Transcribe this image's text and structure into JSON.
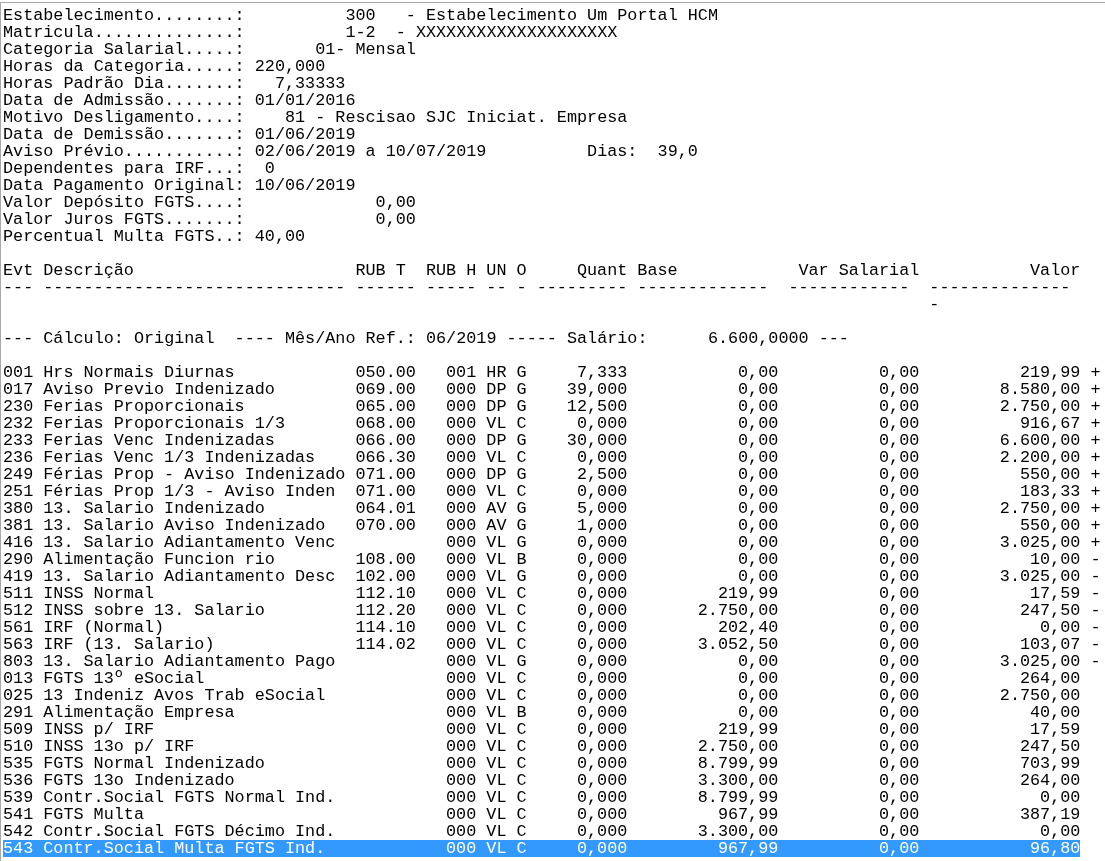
{
  "header_fields": [
    {
      "label": "Estabelecimento........:",
      "value": "300   - Estabelecimento Um Portal HCM"
    },
    {
      "label": "Matricula..............:",
      "value": "1-2  - XXXXXXXXXXXXXXXXXXXX"
    },
    {
      "label": "Categoria Salarial.....:",
      "value": "01- Mensal"
    },
    {
      "label": "Horas da Categoria.....:",
      "value": "220,000"
    },
    {
      "label": "Horas Padrão Dia.......:",
      "value": "7,33333"
    },
    {
      "label": "Data de Admissão.......:",
      "value": "01/01/2016"
    },
    {
      "label": "Motivo Desligamento....:",
      "value": "81 - Rescisao SJC Iniciat. Empresa"
    },
    {
      "label": "Data de Demissão.......:",
      "value": "01/06/2019"
    },
    {
      "label": "Aviso Prévio...........:",
      "value": "02/06/2019 a 10/07/2019",
      "extra_label": "Dias:",
      "extra_value": "39,0"
    },
    {
      "label": "Dependentes para IRF...:",
      "value": "0"
    },
    {
      "label": "Data Pagamento Original:",
      "value": "10/06/2019"
    },
    {
      "label": "Valor Depósito FGTS....:",
      "value": "0,00"
    },
    {
      "label": "Valor Juros FGTS.......:",
      "value": "0,00"
    },
    {
      "label": "Percentual Multa FGTS..:",
      "value": "40,00"
    }
  ],
  "table": {
    "columns": [
      {
        "label": "Evt",
        "rule": "---"
      },
      {
        "label": "Descrição",
        "rule": "------------------------------"
      },
      {
        "label": "RUB T",
        "rule": "------"
      },
      {
        "label": "RUB H",
        "rule": "-----"
      },
      {
        "label": "UN",
        "rule": "--"
      },
      {
        "label": "O",
        "rule": "-"
      },
      {
        "label": "Quant",
        "rule": "---------"
      },
      {
        "label": "Base",
        "rule": "-------------"
      },
      {
        "label": "Var Salarial",
        "rule": "------------"
      },
      {
        "label": "Valor",
        "rule": "--------------"
      }
    ],
    "rule_overflow": "-",
    "calculation_line": "--- Cálculo: Original  ---- Mês/Ano Ref.: 06/2019 ----- Salário:      6.600,0000 ---",
    "rows": [
      {
        "evt": "001",
        "descricao": "Hrs Normais Diurnas",
        "rub_t": "050.00",
        "rub_h": "001",
        "un": "HR",
        "o": "G",
        "quant": "7,333",
        "base": "0,00",
        "var_salarial": "0,00",
        "valor": "219,99",
        "column_11": "+",
        "selected": false
      },
      {
        "evt": "017",
        "descricao": "Aviso Previo Indenizado",
        "rub_t": "069.00",
        "rub_h": "000",
        "un": "DP",
        "o": "G",
        "quant": "39,000",
        "base": "0,00",
        "var_salarial": "0,00",
        "valor": "8.580,00",
        "column_11": "+",
        "selected": false
      },
      {
        "evt": "230",
        "descricao": "Ferias Proporcionais",
        "rub_t": "065.00",
        "rub_h": "000",
        "un": "DP",
        "o": "G",
        "quant": "12,500",
        "base": "0,00",
        "var_salarial": "0,00",
        "valor": "2.750,00",
        "column_11": "+",
        "selected": false
      },
      {
        "evt": "232",
        "descricao": "Ferias Proporcionais 1/3",
        "rub_t": "068.00",
        "rub_h": "000",
        "un": "VL",
        "o": "C",
        "quant": "0,000",
        "base": "0,00",
        "var_salarial": "0,00",
        "valor": "916,67",
        "column_11": "+",
        "selected": false
      },
      {
        "evt": "233",
        "descricao": "Ferias Venc Indenizadas",
        "rub_t": "066.00",
        "rub_h": "000",
        "un": "DP",
        "o": "G",
        "quant": "30,000",
        "base": "0,00",
        "var_salarial": "0,00",
        "valor": "6.600,00",
        "column_11": "+",
        "selected": false
      },
      {
        "evt": "236",
        "descricao": "Ferias Venc 1/3 Indenizadas",
        "rub_t": "066.30",
        "rub_h": "000",
        "un": "VL",
        "o": "C",
        "quant": "0,000",
        "base": "0,00",
        "var_salarial": "0,00",
        "valor": "2.200,00",
        "column_11": "+",
        "selected": false
      },
      {
        "evt": "249",
        "descricao": "Férias Prop - Aviso Indenizado",
        "rub_t": "071.00",
        "rub_h": "000",
        "un": "DP",
        "o": "G",
        "quant": "2,500",
        "base": "0,00",
        "var_salarial": "0,00",
        "valor": "550,00",
        "column_11": "+",
        "selected": false
      },
      {
        "evt": "251",
        "descricao": "Férias Prop 1/3 - Aviso Inden",
        "rub_t": "071.00",
        "rub_h": "000",
        "un": "VL",
        "o": "C",
        "quant": "0,000",
        "base": "0,00",
        "var_salarial": "0,00",
        "valor": "183,33",
        "column_11": "+",
        "selected": false
      },
      {
        "evt": "380",
        "descricao": "13. Salario Indenizado",
        "rub_t": "064.01",
        "rub_h": "000",
        "un": "AV",
        "o": "G",
        "quant": "5,000",
        "base": "0,00",
        "var_salarial": "0,00",
        "valor": "2.750,00",
        "column_11": "+",
        "selected": false
      },
      {
        "evt": "381",
        "descricao": "13. Salario Aviso Indenizado",
        "rub_t": "070.00",
        "rub_h": "000",
        "un": "AV",
        "o": "G",
        "quant": "1,000",
        "base": "0,00",
        "var_salarial": "0,00",
        "valor": "550,00",
        "column_11": "+",
        "selected": false
      },
      {
        "evt": "416",
        "descricao": "13. Salario Adiantamento Venc",
        "rub_h": "000",
        "un": "VL",
        "o": "G",
        "quant": "0,000",
        "base": "0,00",
        "var_salarial": "0,00",
        "valor": "3.025,00",
        "column_11": "+",
        "selected": false
      },
      {
        "evt": "290",
        "descricao": "Alimentação Funcion rio",
        "rub_t": "108.00",
        "rub_h": "000",
        "un": "VL",
        "o": "B",
        "quant": "0,000",
        "base": "0,00",
        "var_salarial": "0,00",
        "valor": "10,00",
        "column_11": "-",
        "selected": false
      },
      {
        "evt": "419",
        "descricao": "13. Salario Adiantamento Desc",
        "rub_t": "102.00",
        "rub_h": "000",
        "un": "VL",
        "o": "G",
        "quant": "0,000",
        "base": "0,00",
        "var_salarial": "0,00",
        "valor": "3.025,00",
        "column_11": "-",
        "selected": false
      },
      {
        "evt": "511",
        "descricao": "INSS Normal",
        "rub_t": "112.10",
        "rub_h": "000",
        "un": "VL",
        "o": "C",
        "quant": "0,000",
        "base": "219,99",
        "var_salarial": "0,00",
        "valor": "17,59",
        "column_11": "-",
        "selected": false
      },
      {
        "evt": "512",
        "descricao": "INSS sobre 13. Salario",
        "rub_t": "112.20",
        "rub_h": "000",
        "un": "VL",
        "o": "C",
        "quant": "0,000",
        "base": "2.750,00",
        "var_salarial": "0,00",
        "valor": "247,50",
        "column_11": "-",
        "selected": false
      },
      {
        "evt": "561",
        "descricao": "IRF (Normal)",
        "rub_t": "114.10",
        "rub_h": "000",
        "un": "VL",
        "o": "C",
        "quant": "0,000",
        "base": "202,40",
        "var_salarial": "0,00",
        "valor": "0,00",
        "column_11": "-",
        "selected": false
      },
      {
        "evt": "563",
        "descricao": "IRF (13. Salario)",
        "rub_t": "114.02",
        "rub_h": "000",
        "un": "VL",
        "o": "C",
        "quant": "0,000",
        "base": "3.052,50",
        "var_salarial": "0,00",
        "valor": "103,07",
        "column_11": "-",
        "selected": false
      },
      {
        "evt": "803",
        "descricao": "13. Salario Adiantamento Pago",
        "rub_h": "000",
        "un": "VL",
        "o": "G",
        "quant": "0,000",
        "base": "0,00",
        "var_salarial": "0,00",
        "valor": "3.025,00",
        "column_11": "-",
        "selected": false
      },
      {
        "evt": "013",
        "descricao": "FGTS 13º eSocial",
        "rub_h": "000",
        "un": "VL",
        "o": "C",
        "quant": "0,000",
        "base": "0,00",
        "var_salarial": "0,00",
        "valor": "264,00",
        "selected": false
      },
      {
        "evt": "025",
        "descricao": "13 Indeniz Avos Trab eSocial",
        "rub_h": "000",
        "un": "VL",
        "o": "C",
        "quant": "0,000",
        "base": "0,00",
        "var_salarial": "0,00",
        "valor": "2.750,00",
        "selected": false
      },
      {
        "evt": "291",
        "descricao": "Alimentação Empresa",
        "rub_h": "000",
        "un": "VL",
        "o": "B",
        "quant": "0,000",
        "base": "0,00",
        "var_salarial": "0,00",
        "valor": "40,00",
        "selected": false
      },
      {
        "evt": "509",
        "descricao": "INSS p/ IRF",
        "rub_h": "000",
        "un": "VL",
        "o": "C",
        "quant": "0,000",
        "base": "219,99",
        "var_salarial": "0,00",
        "valor": "17,59",
        "selected": false
      },
      {
        "evt": "510",
        "descricao": "INSS 13o p/ IRF",
        "rub_h": "000",
        "un": "VL",
        "o": "C",
        "quant": "0,000",
        "base": "2.750,00",
        "var_salarial": "0,00",
        "valor": "247,50",
        "selected": false
      },
      {
        "evt": "535",
        "descricao": "FGTS Normal Indenizado",
        "rub_h": "000",
        "un": "VL",
        "o": "C",
        "quant": "0,000",
        "base": "8.799,99",
        "var_salarial": "0,00",
        "valor": "703,99",
        "selected": false
      },
      {
        "evt": "536",
        "descricao": "FGTS 13o Indenizado",
        "rub_h": "000",
        "un": "VL",
        "o": "C",
        "quant": "0,000",
        "base": "3.300,00",
        "var_salarial": "0,00",
        "valor": "264,00",
        "selected": false
      },
      {
        "evt": "539",
        "descricao": "Contr.Social FGTS Normal Ind.",
        "rub_h": "000",
        "un": "VL",
        "o": "C",
        "quant": "0,000",
        "base": "8.799,99",
        "var_salarial": "0,00",
        "valor": "0,00",
        "selected": false
      },
      {
        "evt": "541",
        "descricao": "FGTS Multa",
        "rub_h": "000",
        "un": "VL",
        "o": "C",
        "quant": "0,000",
        "base": "967,99",
        "var_salarial": "0,00",
        "valor": "387,19",
        "selected": false
      },
      {
        "evt": "542",
        "descricao": "Contr.Social FGTS Décimo Ind.",
        "rub_h": "000",
        "un": "VL",
        "o": "C",
        "quant": "0,000",
        "base": "3.300,00",
        "var_salarial": "0,00",
        "valor": "0,00",
        "selected": false
      },
      {
        "evt": "543",
        "descricao": "Contr.Social Multa FGTS Ind.",
        "rub_h": "000",
        "un": "VL",
        "o": "C",
        "quant": "0,000",
        "base": "967,99",
        "var_salarial": "0,00",
        "valor": "96,80",
        "selected": true
      }
    ]
  }
}
